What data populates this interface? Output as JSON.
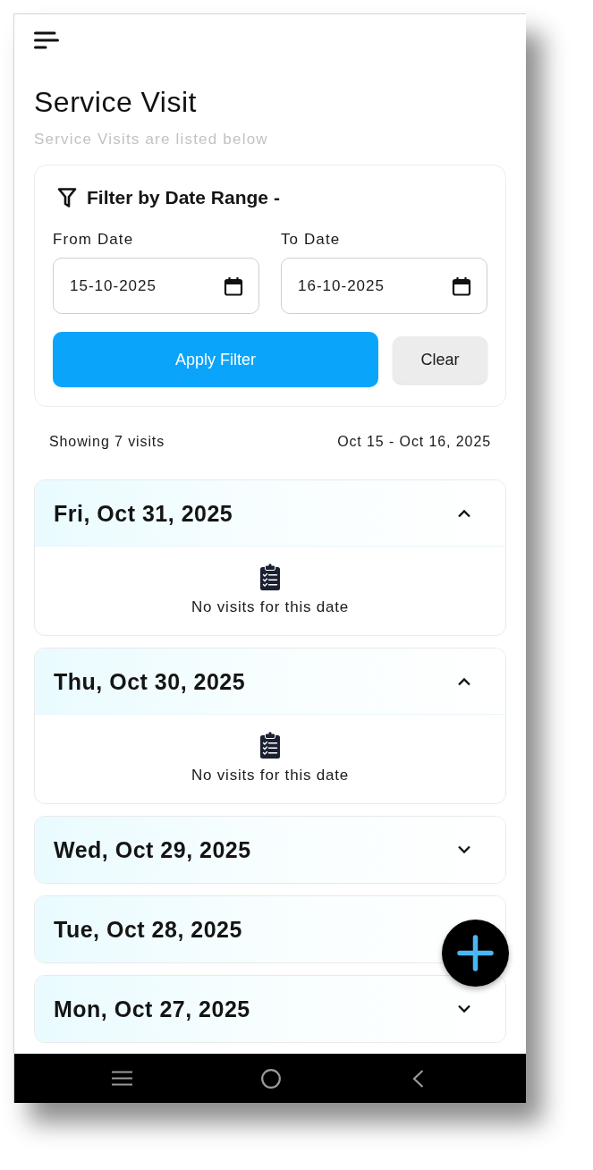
{
  "header": {
    "title": "Service Visit",
    "subtitle": "Service Visits are listed below"
  },
  "filter": {
    "title": "Filter by Date Range -",
    "fields": [
      {
        "label": "From Date",
        "value": "15-10-2025"
      },
      {
        "label": "To Date",
        "value": "16-10-2025"
      }
    ],
    "buttons": [
      {
        "label": "Apply Filter",
        "kind": "primary"
      },
      {
        "label": "Clear",
        "kind": "secondary"
      }
    ]
  },
  "summary": {
    "count": "Showing 7 visits",
    "range": "Oct 15 - Oct 16, 2025"
  },
  "date_groups": [
    {
      "date": "Fri, Oct 31, 2025",
      "expanded": true,
      "empty_message": "No visits for this date"
    },
    {
      "date": "Thu, Oct 30, 2025",
      "expanded": true,
      "empty_message": "No visits for this date"
    },
    {
      "date": "Wed, Oct 29, 2025",
      "expanded": false
    },
    {
      "date": "Tue, Oct 28, 2025",
      "expanded": false
    },
    {
      "date": "Mon, Oct 27, 2025",
      "expanded": false
    }
  ]
}
